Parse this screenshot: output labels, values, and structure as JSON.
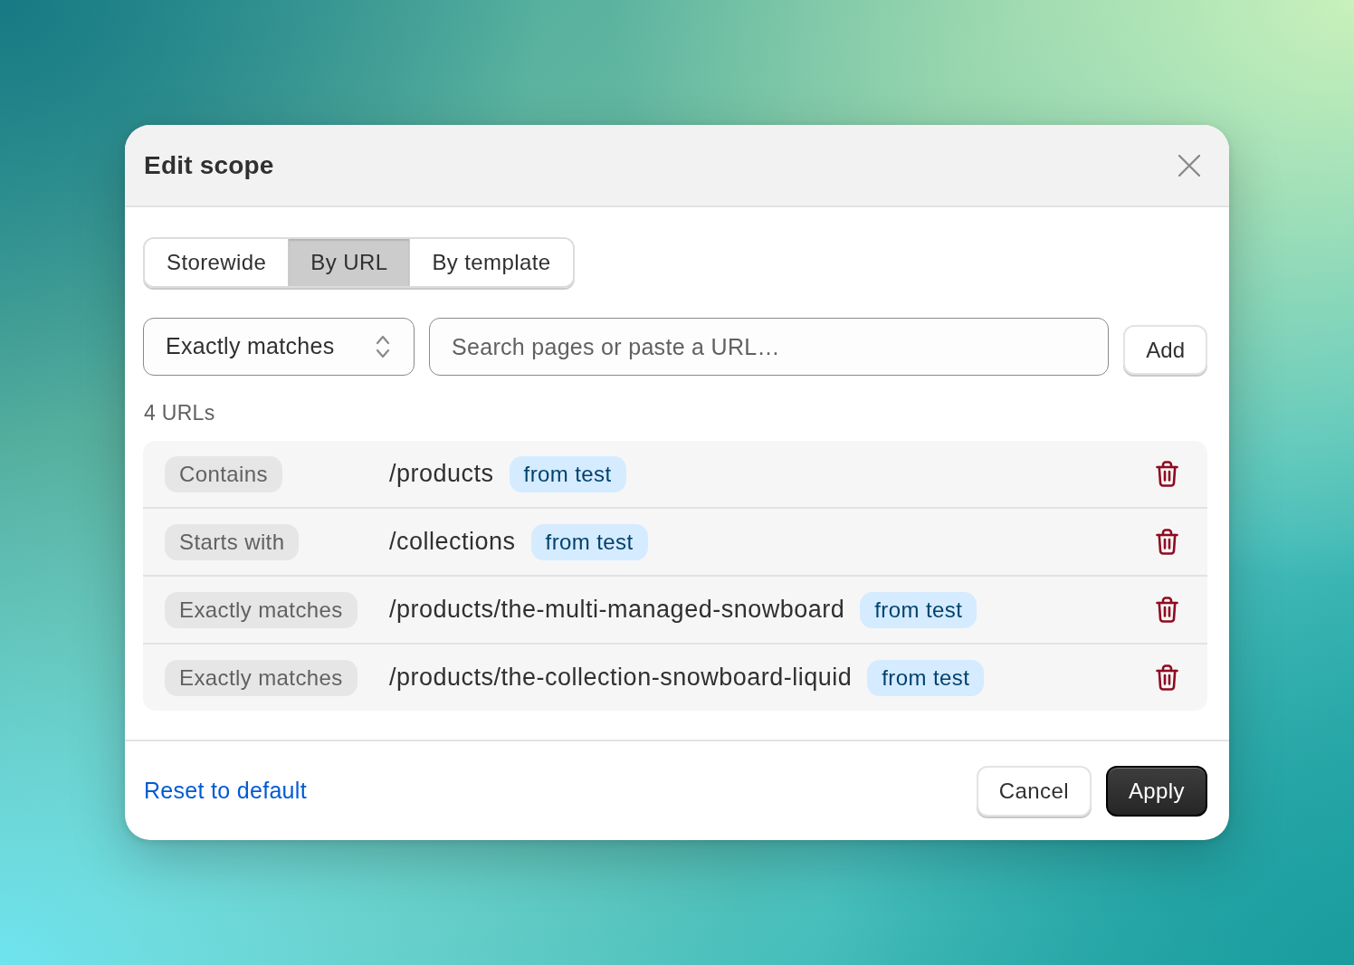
{
  "dialog": {
    "title": "Edit scope"
  },
  "tabs": [
    {
      "label": "Storewide",
      "selected": false
    },
    {
      "label": "By URL",
      "selected": true
    },
    {
      "label": "By template",
      "selected": false
    }
  ],
  "match_select": {
    "value": "Exactly matches"
  },
  "search": {
    "placeholder": "Search pages or paste a URL…"
  },
  "add_button": {
    "label": "Add"
  },
  "url_count": "4 URLs",
  "urls": [
    {
      "match": "Contains",
      "path": "/products",
      "tag": "from test"
    },
    {
      "match": "Starts with",
      "path": "/collections",
      "tag": "from test"
    },
    {
      "match": "Exactly matches",
      "path": "/products/the-multi-managed-snowboard",
      "tag": "from test"
    },
    {
      "match": "Exactly matches",
      "path": "/products/the-collection-snowboard-liquid",
      "tag": "from test"
    }
  ],
  "footer": {
    "reset_link": "Reset to default",
    "buttons": [
      {
        "label": "Cancel",
        "kind": "secondary"
      },
      {
        "label": "Apply",
        "kind": "primary"
      }
    ]
  }
}
